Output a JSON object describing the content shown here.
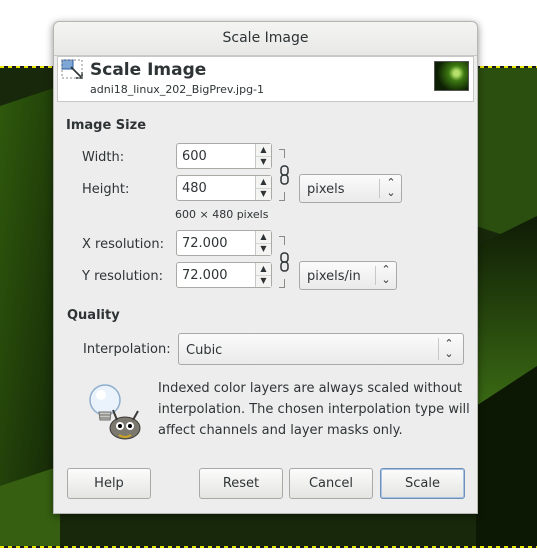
{
  "window": {
    "title": "Scale Image"
  },
  "header": {
    "title": "Scale Image",
    "filename": "adni18_linux_202_BigPrev.jpg-1"
  },
  "image_size": {
    "section_label": "Image Size",
    "width_label": "Width:",
    "width_value": "600",
    "height_label": "Height:",
    "height_value": "480",
    "unit_value": "pixels",
    "size_info": "600 × 480 pixels",
    "xres_label": "X resolution:",
    "xres_value": "72.000",
    "yres_label": "Y resolution:",
    "yres_value": "72.000",
    "res_unit_value": "pixels/in"
  },
  "quality": {
    "section_label": "Quality",
    "interpolation_label": "Interpolation:",
    "interpolation_value": "Cubic",
    "note": "Indexed color layers are always scaled without interpolation. The chosen interpolation type will affect channels and layer masks only."
  },
  "buttons": {
    "help": "Help",
    "reset": "Reset",
    "cancel": "Cancel",
    "scale": "Scale"
  },
  "colors": {
    "dialog_bg": "#ededed",
    "default_button_border": "#6e8fb9",
    "canvas_green": "#1a2c0a"
  },
  "icons": {
    "header_icon": "scale-image-icon",
    "chain_icons": "chain-link-icon",
    "info_illustration": "wilber-lightbulb-icon"
  }
}
